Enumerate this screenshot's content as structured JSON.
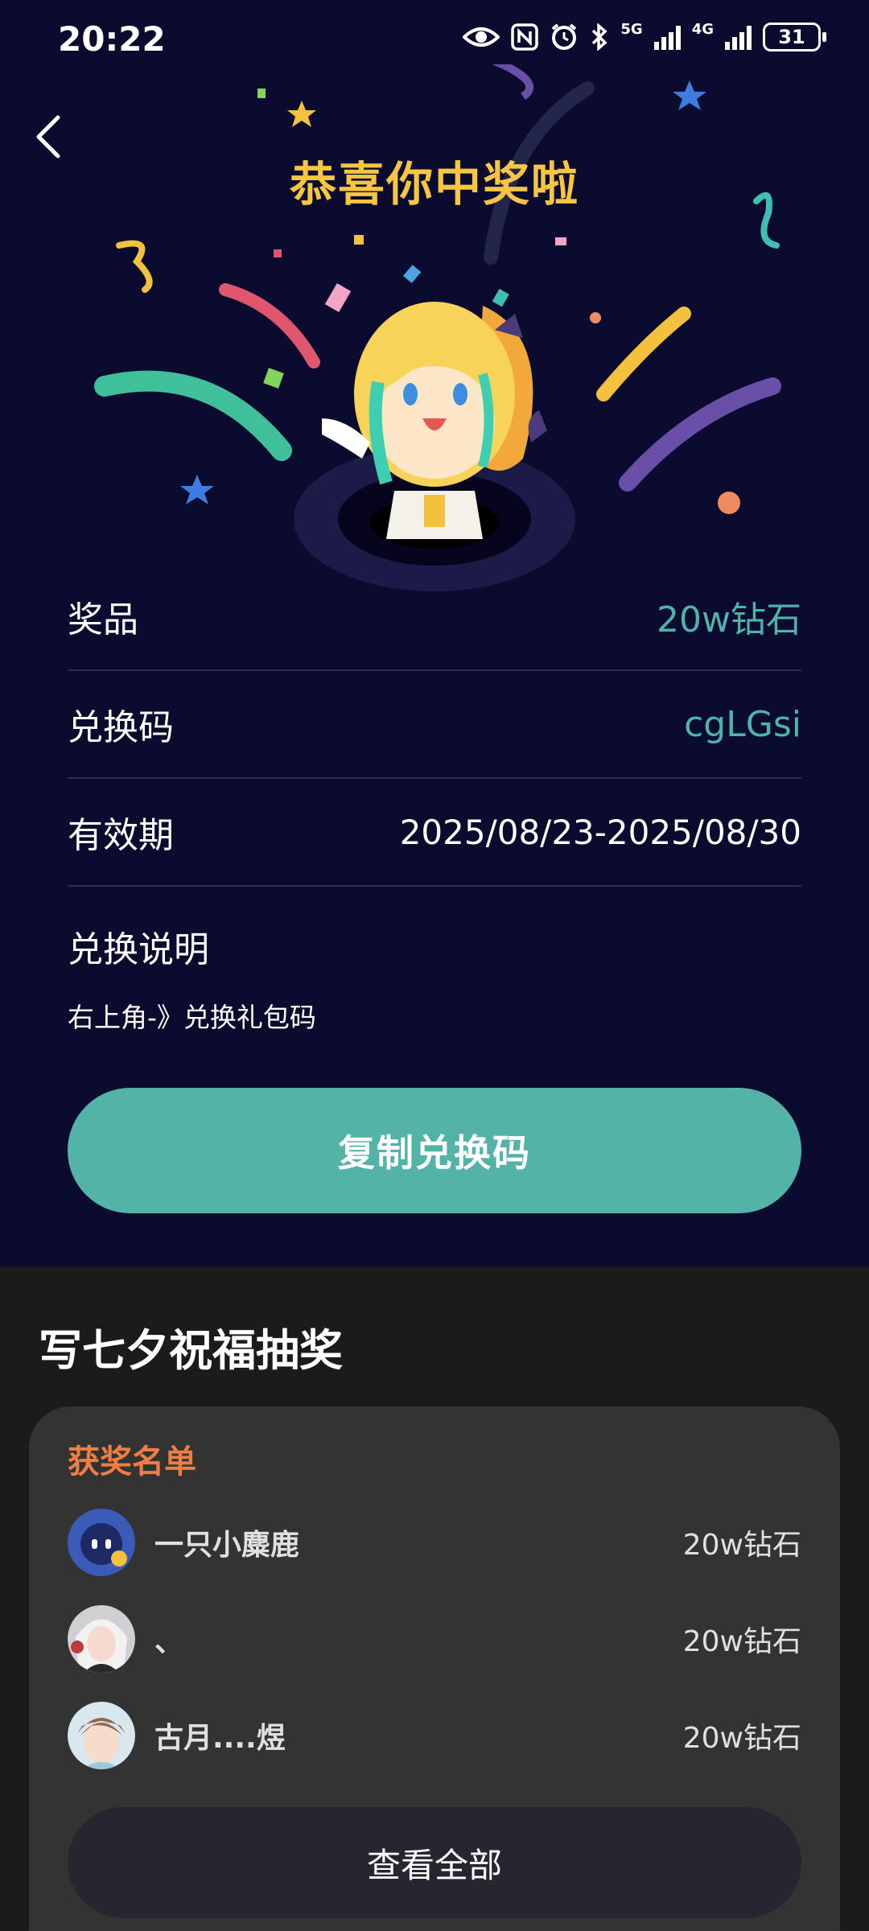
{
  "status_bar": {
    "time": "20:22",
    "net1": "5G",
    "net2": "4G",
    "battery": "31"
  },
  "header": {
    "title": "恭喜你中奖啦"
  },
  "details": {
    "prize_label": "奖品",
    "prize_value": "20w钻石",
    "code_label": "兑换码",
    "code_value": "cgLGsi",
    "validity_label": "有效期",
    "validity_value": "2025/08/23-2025/08/30",
    "explain_label": "兑换说明",
    "explain_text": "右上角-》兑换礼包码"
  },
  "copy_button": "复制兑换码",
  "section": {
    "title": "写七夕祝福抽奖",
    "winners_title": "获奖名单",
    "winners": [
      {
        "name": "一只小麋鹿",
        "prize": "20w钻石"
      },
      {
        "name": "、",
        "prize": "20w钻石"
      },
      {
        "name": "古月....煜",
        "prize": "20w钻石"
      }
    ],
    "view_all": "查看全部"
  },
  "colors": {
    "top_background": "#0b0a2f",
    "title": "#f6c542",
    "accent_teal": "#52b3a6",
    "winners_title": "#f07d44",
    "card": "#333333"
  }
}
